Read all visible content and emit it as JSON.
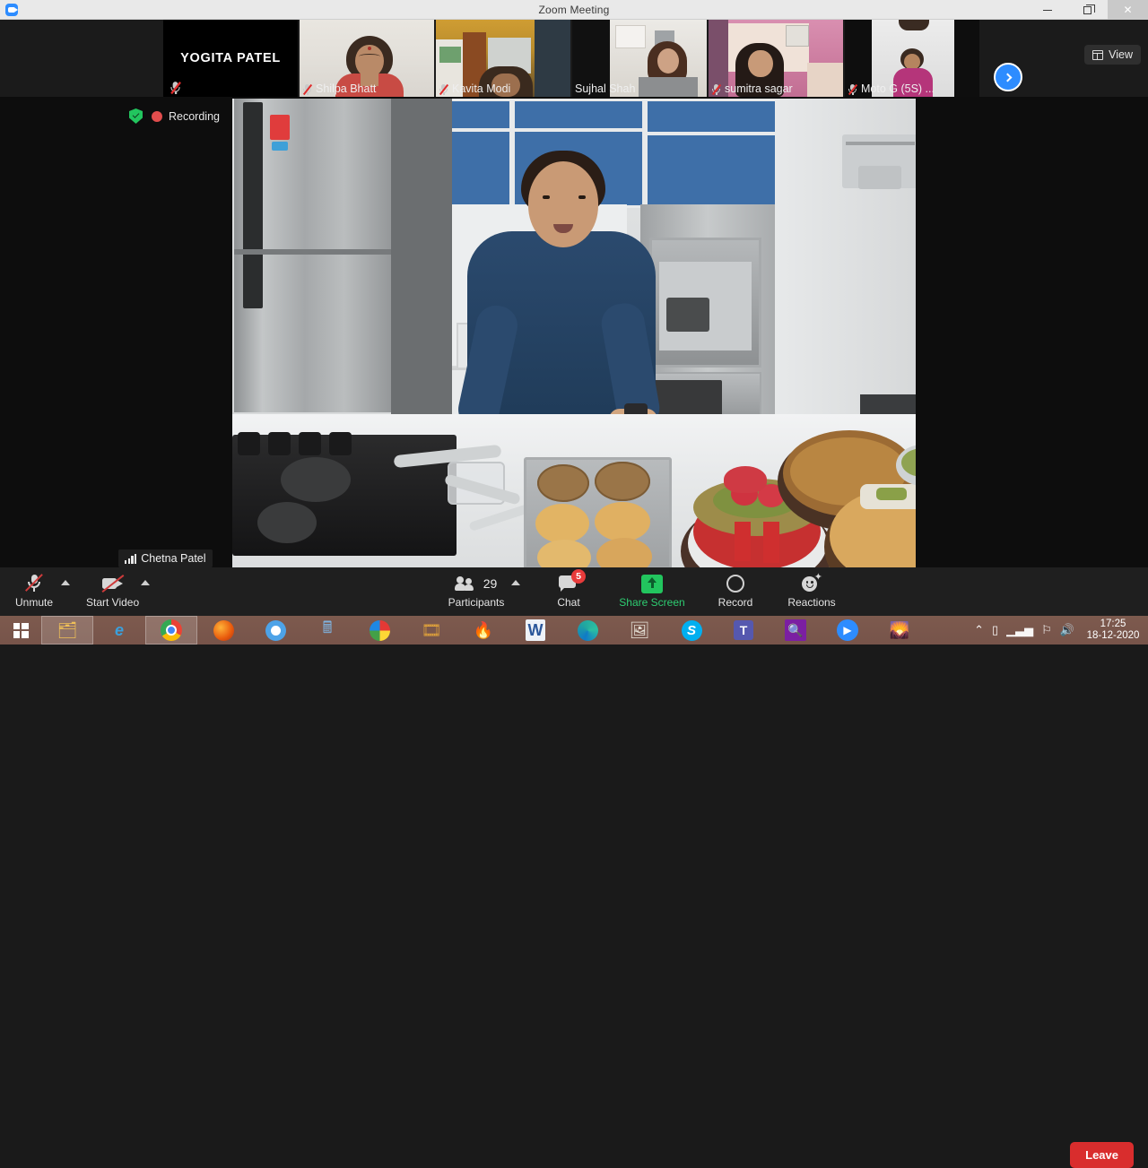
{
  "window": {
    "title": "Zoom Meeting",
    "app_icon": "zoom-icon",
    "controls": {
      "minimize": "–",
      "maximize": "❐",
      "close": "✕"
    }
  },
  "filmstrip": {
    "view_button": {
      "label": "View",
      "icon": "grid-view-icon"
    },
    "next_button": {
      "icon": "chevron-right-icon"
    },
    "participants": [
      {
        "name": "YOGITA PATEL",
        "muted": true,
        "self": true,
        "video_off": true
      },
      {
        "name": "Shilpa Bhatt",
        "muted": true,
        "self": false,
        "video_off": false
      },
      {
        "name": "Kavita Modi",
        "muted": true,
        "self": false,
        "video_off": false
      },
      {
        "name": "Sujhal Shah",
        "muted": false,
        "self": false,
        "video_off": false
      },
      {
        "name": "sumitra sagar",
        "muted": true,
        "self": false,
        "video_off": false
      },
      {
        "name": "Moto G (5S) ...",
        "muted": true,
        "self": false,
        "video_off": false
      }
    ]
  },
  "stage": {
    "encryption_icon": "shield-check-icon",
    "recording_icon": "recording-dot-icon",
    "recording_label": "Recording",
    "active_speaker": {
      "name": "Chetna Patel",
      "icon": "audio-level-icon"
    }
  },
  "toolbar": {
    "audio": {
      "label": "Unmute",
      "icon": "mic-muted-icon",
      "has_menu": true
    },
    "video": {
      "label": "Start Video",
      "icon": "camera-off-icon",
      "has_menu": true
    },
    "participants": {
      "label": "Participants",
      "icon": "people-icon",
      "count": "29",
      "has_menu": true
    },
    "chat": {
      "label": "Chat",
      "icon": "chat-bubble-icon",
      "unread": "5"
    },
    "share": {
      "label": "Share Screen",
      "icon": "share-screen-icon",
      "color": "#2ecc71"
    },
    "record": {
      "label": "Record",
      "icon": "record-circle-icon"
    },
    "reactions": {
      "label": "Reactions",
      "icon": "reactions-smiley-icon"
    },
    "leave": {
      "label": "Leave",
      "color": "#d92d2d"
    }
  },
  "taskbar": {
    "start": {
      "icon": "windows-start-icon"
    },
    "apps": [
      {
        "icon": "file-explorer-icon",
        "glyph": "🗂",
        "active": true
      },
      {
        "icon": "internet-explorer-icon",
        "glyph": "🅮",
        "active": false
      },
      {
        "icon": "google-chrome-icon",
        "glyph": "◍",
        "active": true
      },
      {
        "icon": "firefox-icon",
        "glyph": "🦊",
        "active": false
      },
      {
        "icon": "chromium-icon",
        "glyph": "◎",
        "active": false
      },
      {
        "icon": "calculator-icon",
        "glyph": "🖩",
        "active": false
      },
      {
        "icon": "picasa-icon",
        "glyph": "✿",
        "active": false
      },
      {
        "icon": "media-player-icon",
        "glyph": "🎞",
        "active": false
      },
      {
        "icon": "burn-tool-icon",
        "glyph": "🔥",
        "active": false
      },
      {
        "icon": "microsoft-word-icon",
        "glyph": "W",
        "active": false
      },
      {
        "icon": "microsoft-edge-icon",
        "glyph": "◑",
        "active": false
      },
      {
        "icon": "photo-viewer-icon",
        "glyph": "🖼",
        "active": false
      },
      {
        "icon": "skype-icon",
        "glyph": "S",
        "active": false
      },
      {
        "icon": "microsoft-teams-icon",
        "glyph": "T",
        "active": false
      },
      {
        "icon": "search-icon",
        "glyph": "🔍",
        "active": false
      },
      {
        "icon": "zoom-app-icon",
        "glyph": "▣",
        "active": false
      },
      {
        "icon": "photos-icon",
        "glyph": "🌄",
        "active": false
      }
    ],
    "tray": {
      "show_hidden_icon": "chevron-up-icon",
      "battery_icon": "battery-icon",
      "signal_icon": "signal-bars-icon",
      "network_icon": "network-flag-icon",
      "volume_icon": "speaker-icon",
      "time": "17:25",
      "date": "18-12-2020"
    }
  }
}
